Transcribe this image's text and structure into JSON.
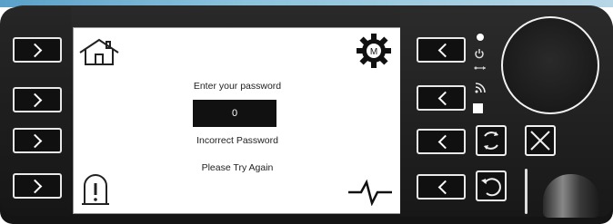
{
  "screen": {
    "prompt": "Enter your password",
    "password_value": "0",
    "error_line1": "Incorrect Password",
    "error_line2": "Please Try Again",
    "menu_badge": "M"
  },
  "icons": {
    "home": "home-icon",
    "menu": "gear-icon",
    "alarm": "warning-bell-icon",
    "pulse": "heartbeat-icon",
    "power": "power-icon",
    "usb": "usb-icon",
    "wifi": "wifi-icon",
    "cycle": "rotate-icon",
    "cancel": "x-icon",
    "undo": "undo-icon"
  },
  "colors": {
    "bezel": "#1b1b1b",
    "screen": "#ffffff",
    "password_box": "#111111",
    "button_border": "#e9e9e9"
  }
}
